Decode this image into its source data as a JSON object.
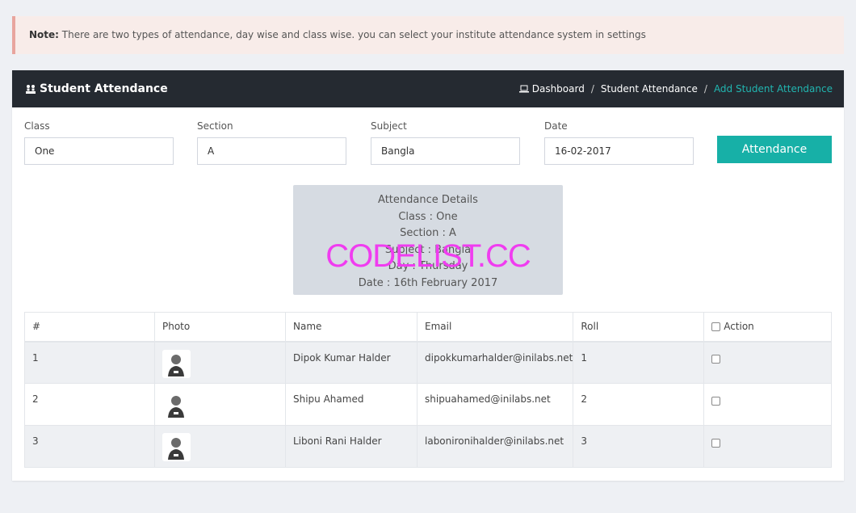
{
  "note": {
    "label": "Note:",
    "text": "There are two types of attendance, day wise and class wise. you can select your institute attendance system in settings"
  },
  "header": {
    "title": "Student Attendance",
    "breadcrumb": [
      "Dashboard",
      "Student Attendance",
      "Add Student Attendance"
    ]
  },
  "form": {
    "class": {
      "label": "Class",
      "value": "One"
    },
    "section": {
      "label": "Section",
      "value": "A"
    },
    "subject": {
      "label": "Subject",
      "value": "Bangla"
    },
    "date": {
      "label": "Date",
      "value": "16-02-2017"
    },
    "submit_label": "Attendance"
  },
  "details": {
    "title": "Attendance Details",
    "class": "Class : One",
    "section": "Section : A",
    "subject": "Subject : Bangla",
    "day": "Day : Thursday",
    "date": "Date : 16th February 2017"
  },
  "watermark": "CODELIST.CC",
  "table": {
    "headers": [
      "#",
      "Photo",
      "Name",
      "Email",
      "Roll",
      "Action"
    ],
    "rows": [
      {
        "num": "1",
        "name": "Dipok Kumar Halder",
        "email": "dipokkumarhalder@inilabs.net",
        "roll": "1"
      },
      {
        "num": "2",
        "name": "Shipu Ahamed",
        "email": "shipuahamed@inilabs.net",
        "roll": "2"
      },
      {
        "num": "3",
        "name": "Liboni Rani Halder",
        "email": "labonironihalder@inilabs.net",
        "roll": "3"
      }
    ]
  },
  "colors": {
    "accent": "#17b0a7",
    "header_bg": "#252a31",
    "active_breadcrumb": "#21b5b0"
  },
  "icons": {
    "title": "people-icon",
    "dashboard": "laptop-icon",
    "avatar": "user-avatar-icon"
  }
}
